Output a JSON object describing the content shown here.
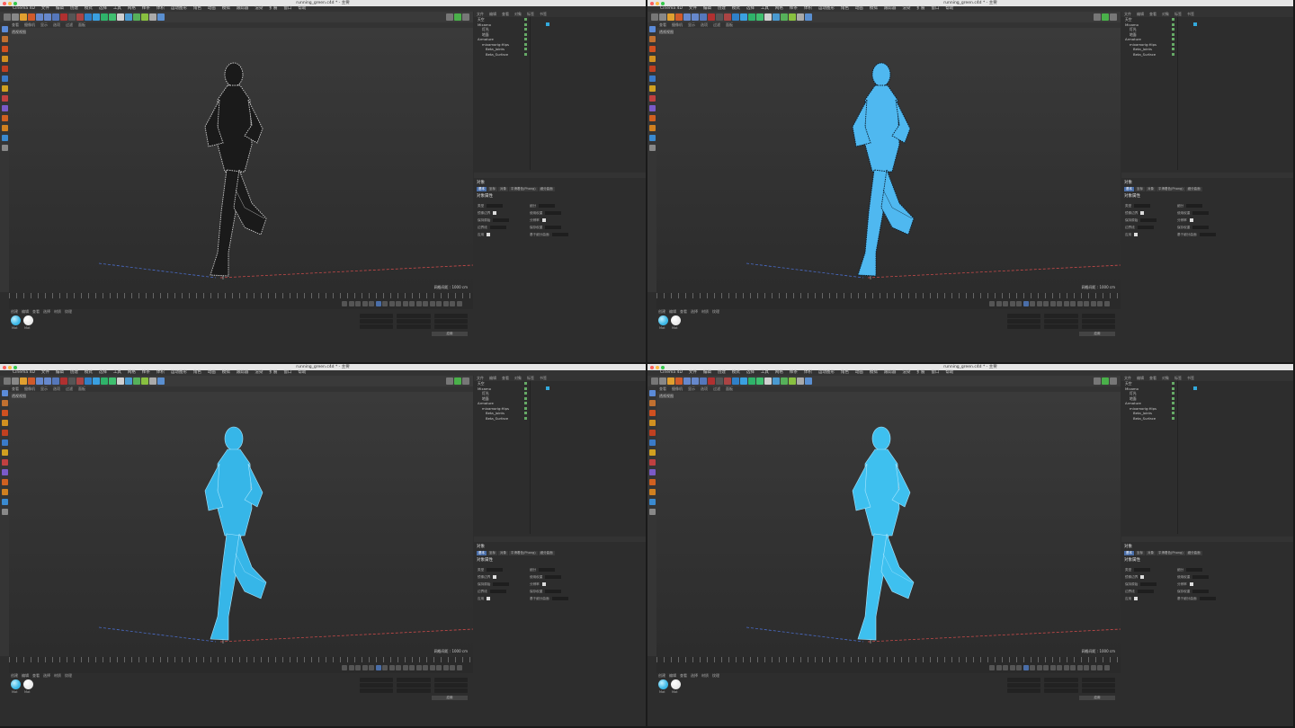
{
  "window": {
    "title": "running_green.c4d * - 主要",
    "app_menu": [
      "Cinema 4D",
      "文件",
      "编辑",
      "创建",
      "模式",
      "选择",
      "工具",
      "网格",
      "样条",
      "体积",
      "运动图形",
      "角色",
      "动画",
      "模拟",
      "跟踪器",
      "渲染",
      "扩展",
      "窗口",
      "帮助"
    ]
  },
  "viewport": {
    "menu": [
      "查看",
      "摄像机",
      "显示",
      "选项",
      "过滤",
      "面板"
    ],
    "label": "透视视图",
    "info": "网格间距 : 1000 cm"
  },
  "object_manager": {
    "tabs": [
      "文件",
      "编辑",
      "查看",
      "对象",
      "标签",
      "书签"
    ],
    "rows": [
      {
        "label": "天空",
        "level": 1
      },
      {
        "label": "Mixamo",
        "level": 1
      },
      {
        "label": "灯光",
        "level": 2
      },
      {
        "label": "地面",
        "level": 2
      },
      {
        "label": "Armature",
        "level": 1
      },
      {
        "label": "mixamorig:Hips",
        "level": 2
      },
      {
        "label": "Beta_Joints",
        "level": 3
      },
      {
        "label": "Beta_Surface",
        "level": 3
      }
    ]
  },
  "attributes": {
    "title": "对象",
    "tabs": [
      "基本",
      "坐标",
      "对象",
      "平滑着色(Phong)",
      "细分曲面"
    ],
    "section": "对象属性",
    "rows": [
      "类型",
      "细分",
      "镜像边界",
      "使用权重",
      "保持原始",
      "分辨率",
      "边界线",
      "保存权重",
      "应用",
      "基于细分曲面"
    ]
  },
  "timeline": {
    "frame_start": "0 F",
    "frame_end": "90 F"
  },
  "materials": {
    "menu": [
      "创建",
      "编辑",
      "查看",
      "选择",
      "材质",
      "纹理"
    ],
    "items": [
      {
        "label": "Mat",
        "color": "#3bb7e6"
      },
      {
        "label": "Mat",
        "color": "#e8e8e8"
      }
    ]
  },
  "coordinates": {
    "apply_label": "应用",
    "mode": "对象 (相对)",
    "size": "绝对尺寸"
  },
  "panels": [
    {
      "style": "wireframe-dark",
      "accent": "#111111"
    },
    {
      "style": "wireframe-blue",
      "accent": "#4fb8f0"
    },
    {
      "style": "shaded-blue",
      "accent": "#36b6e8"
    },
    {
      "style": "shaded-blue",
      "accent": "#3ec0ef"
    }
  ]
}
